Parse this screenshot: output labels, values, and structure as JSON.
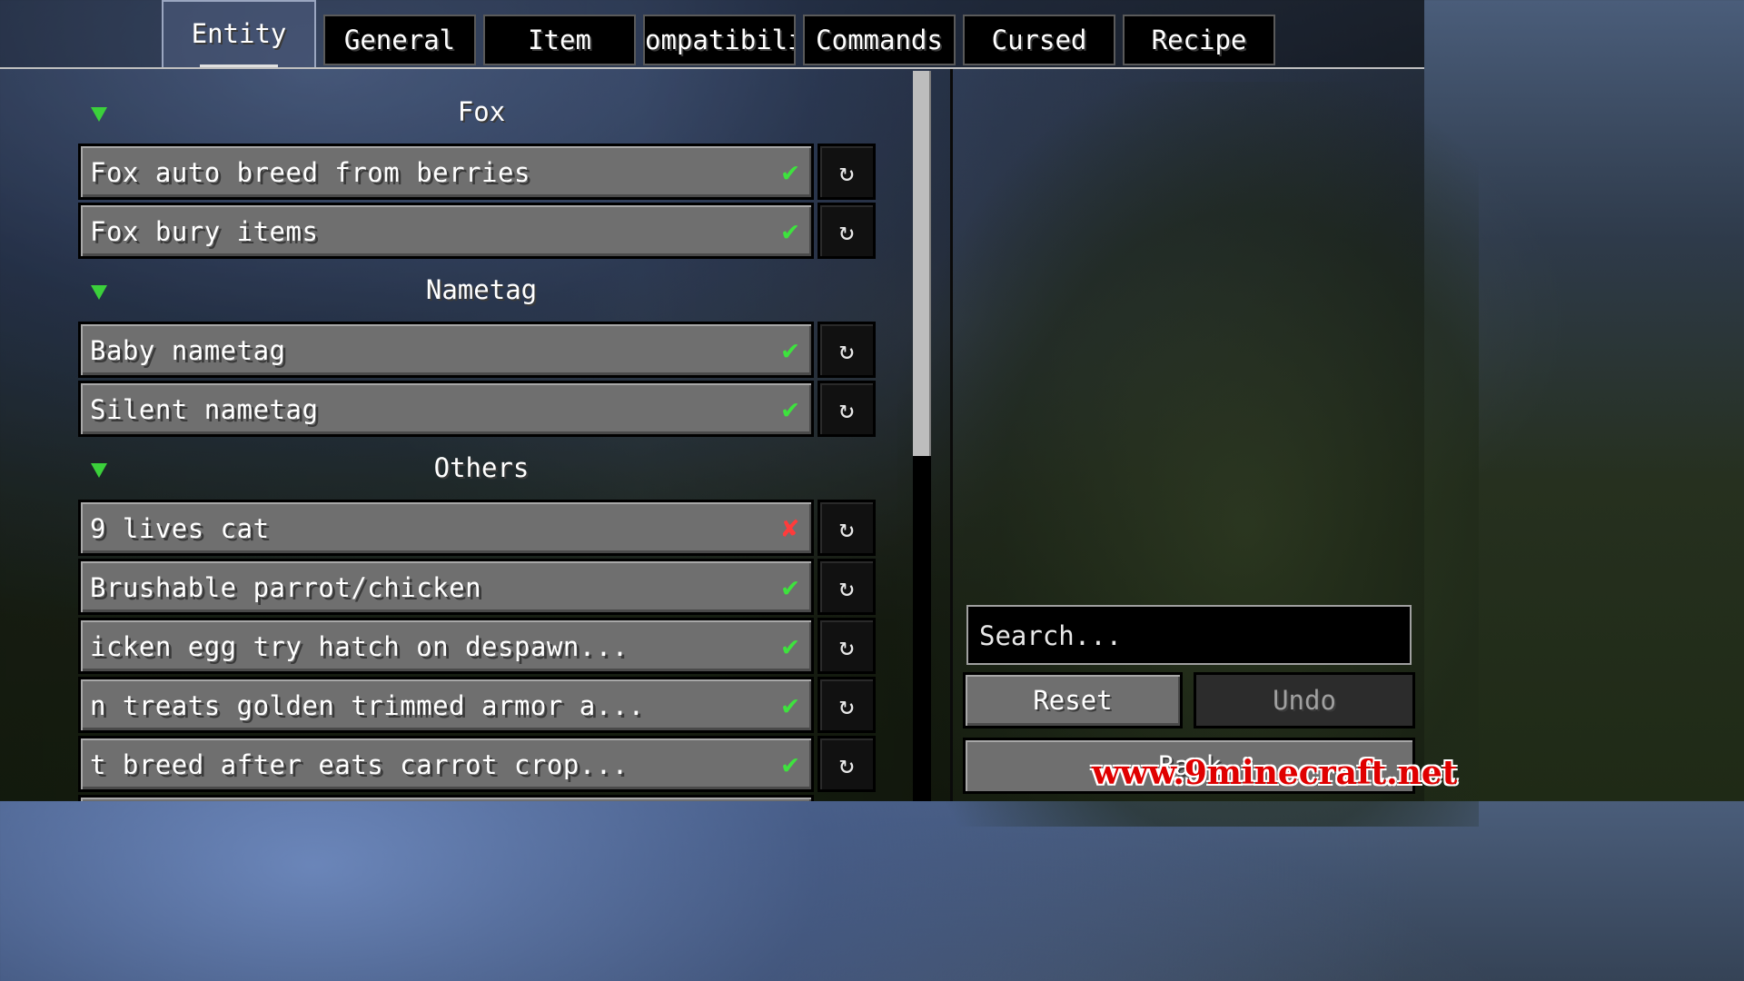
{
  "tabs": [
    {
      "label": "Entity",
      "active": true
    },
    {
      "label": "General",
      "active": false
    },
    {
      "label": "Item",
      "active": false
    },
    {
      "label": "ompatibility",
      "active": false
    },
    {
      "label": "Commands",
      "active": false
    },
    {
      "label": "Cursed",
      "active": false
    },
    {
      "label": "Recipe",
      "active": false
    }
  ],
  "categories": [
    {
      "title": "Fox"
    },
    {
      "title": "Nametag"
    },
    {
      "title": "Others"
    }
  ],
  "rows": [
    {
      "label": "Fox auto breed from berries",
      "state": "✔"
    },
    {
      "label": "Fox bury items",
      "state": "✔"
    },
    {
      "label": "Baby nametag",
      "state": "✔"
    },
    {
      "label": "Silent nametag",
      "state": "✔"
    },
    {
      "label": "9 lives cat",
      "state": "✘"
    },
    {
      "label": "Brushable parrot/chicken",
      "state": "✔"
    },
    {
      "label": "icken egg try hatch on despawn...",
      "state": "✔"
    },
    {
      "label": "n treats golden trimmed armor a...",
      "state": "✔"
    },
    {
      "label": "t breed after eats carrot crop...",
      "state": "✔"
    }
  ],
  "reset_icon": "↻",
  "icons": {
    "toggle_on": "check-icon",
    "toggle_off": "cross-icon",
    "reset": "reset-arrow-icon",
    "expand": "triangle-down-icon"
  },
  "colors": {
    "check": "#3ee23e",
    "cross": "#ff3b3b",
    "arrow": "#3bd03b",
    "watermark": "#e00000"
  },
  "search": {
    "placeholder": "Search..."
  },
  "buttons": {
    "reset": "Reset",
    "undo": "Undo",
    "back": "Back"
  },
  "watermark": "www.9minecraft.net"
}
